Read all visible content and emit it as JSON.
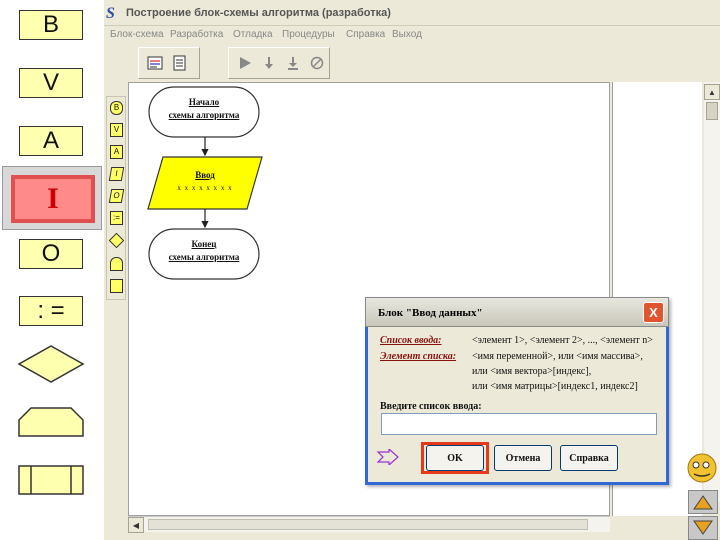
{
  "palette": {
    "begin_label": "B",
    "output_label": "V",
    "assign_a_label": "A",
    "input_label": "I",
    "o_label": "O",
    "assign_label": ": ="
  },
  "window": {
    "title": "Построение блок-схемы алгоритма (разработка)",
    "app_icon": "S",
    "menu": [
      "Блок-схема",
      "Разработка",
      "Отладка",
      "Процедуры",
      "Справка",
      "Выход"
    ]
  },
  "side_tool_labels": [
    "B",
    "V",
    "A",
    "I",
    "O",
    ":=",
    "",
    "",
    ""
  ],
  "flowchart": {
    "start_line1": "Начало",
    "start_line2": "схемы алгоритма",
    "input_title": "Ввод",
    "input_dots": "x x x x x x x x",
    "end_line1": "Конец",
    "end_line2": "схемы алгоритма"
  },
  "dialog": {
    "title": "Блок \"Ввод данных\"",
    "close": "X",
    "list_label": "Список ввода:",
    "list_value": "<элемент 1>, <элемент 2>, ..., <элемент n>",
    "element_label": "Элемент списка:",
    "element_value": "<имя переменной>,  или  <имя массива>,",
    "element_line2": "или   <имя вектора>[индекс],",
    "element_line3": "или   <имя матрицы>[индекс1, индекс2]",
    "input_prompt": "Введите список ввода:",
    "input_value": "",
    "ok": "OK",
    "cancel": "Отмена",
    "help": "Справка"
  },
  "colors": {
    "palette_fill": "#ffffb0",
    "input_block_fill": "#ffff00",
    "selected_fill": "#ff8a8a",
    "dialog_label": "#8b1010",
    "ok_highlight": "#e53a1a"
  }
}
